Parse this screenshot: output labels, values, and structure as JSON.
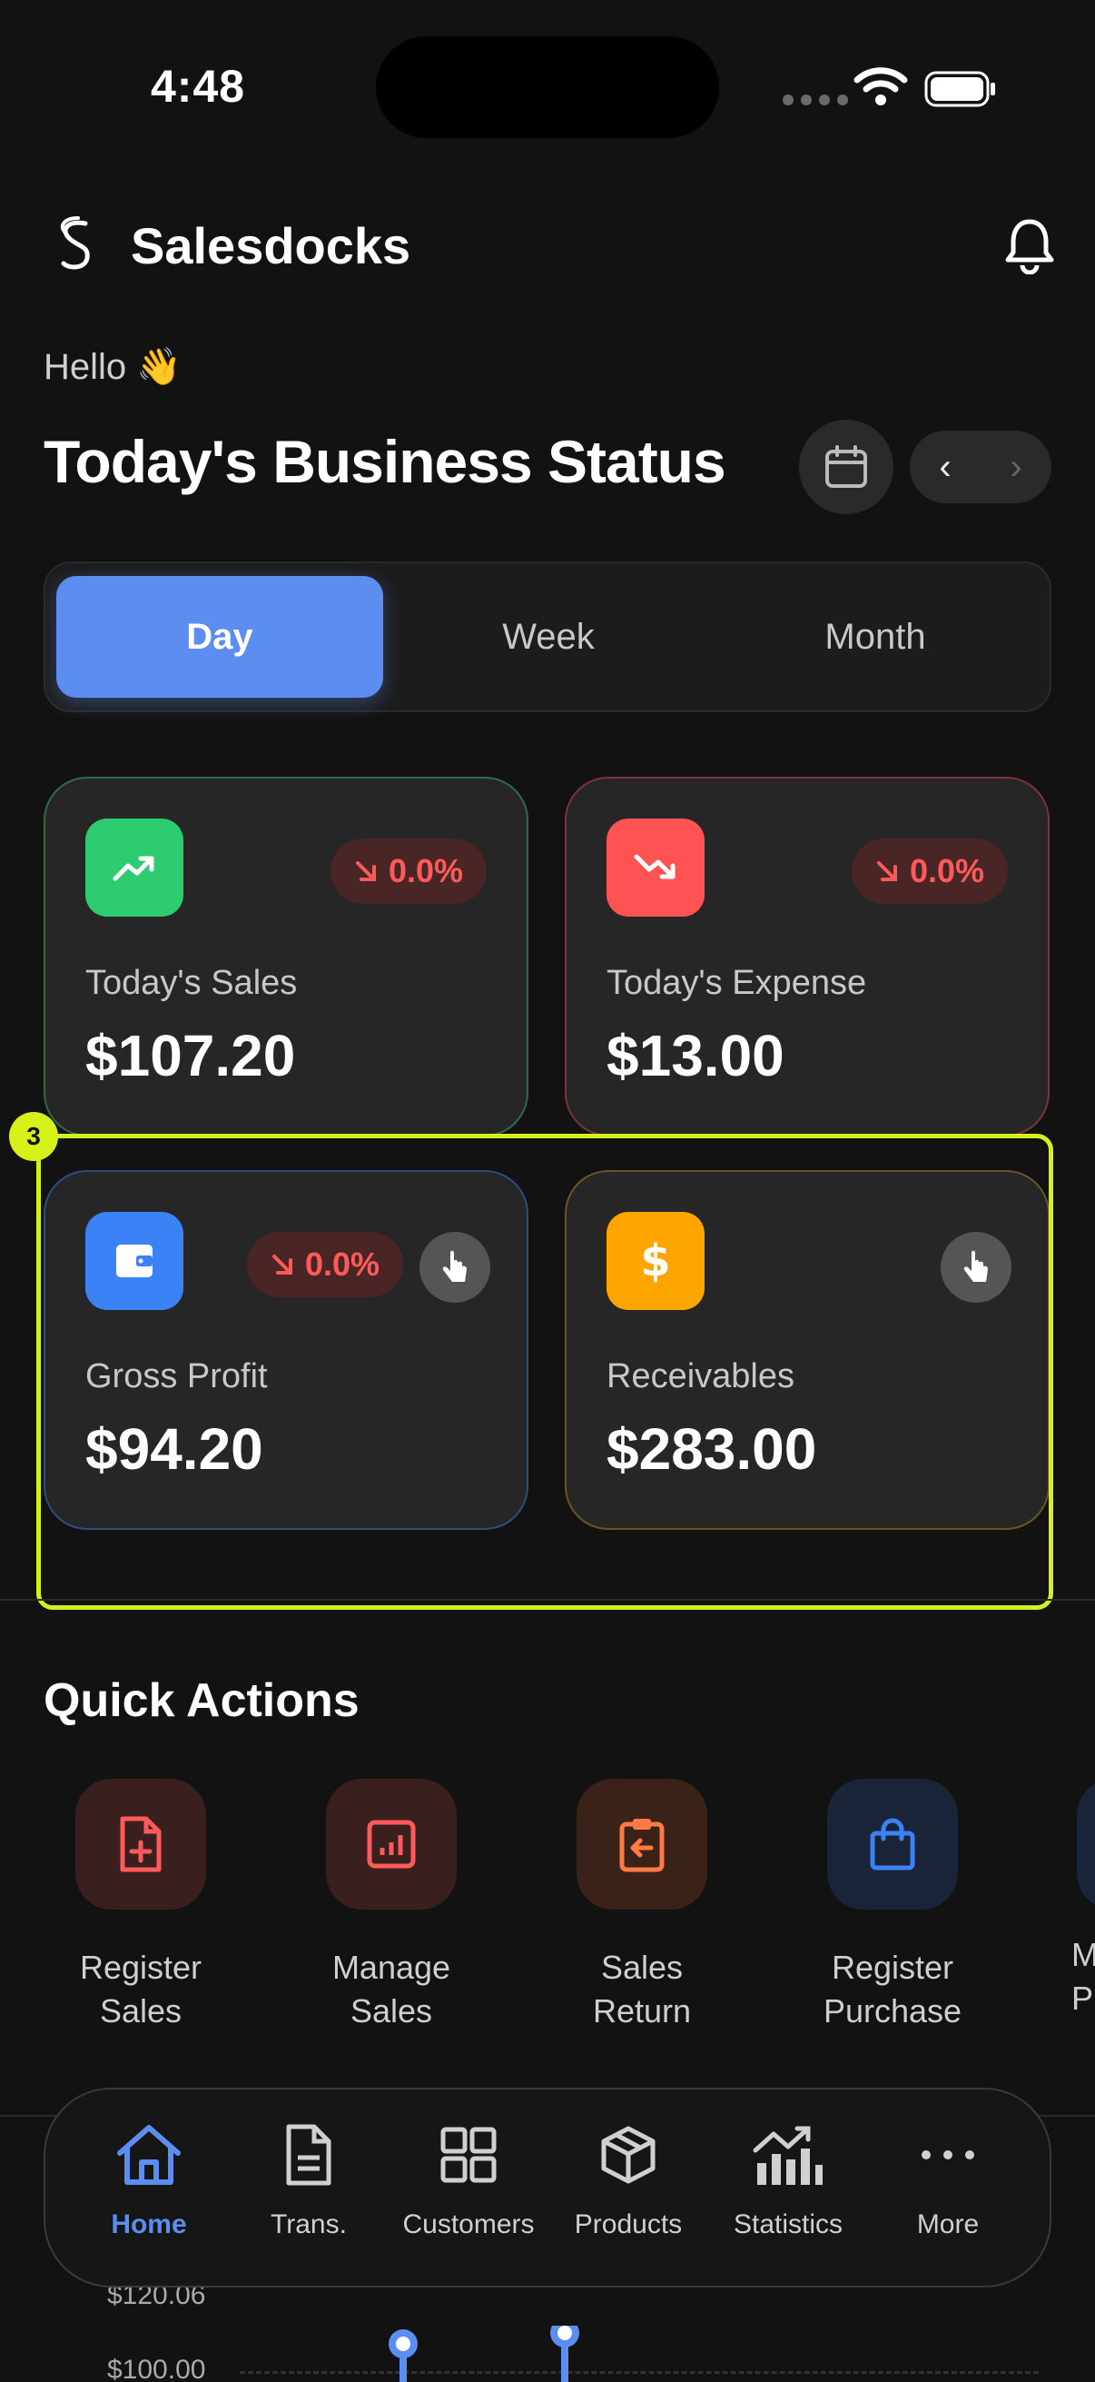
{
  "status_bar": {
    "time": "4:48"
  },
  "header": {
    "brand": "Salesdocks",
    "greeting": "Hello 👋",
    "title": "Today's Business Status"
  },
  "segments": [
    {
      "label": "Day",
      "active": true
    },
    {
      "label": "Week",
      "active": false
    },
    {
      "label": "Month",
      "active": false
    }
  ],
  "cards": {
    "sales": {
      "label": "Today's Sales",
      "value": "$107.20",
      "change": "0.0%",
      "accent": "#2ecc71"
    },
    "expense": {
      "label": "Today's Expense",
      "value": "$13.00",
      "change": "0.0%",
      "accent": "#ff5252"
    },
    "profit": {
      "label": "Gross Profit",
      "value": "$94.20",
      "change": "0.0%",
      "accent": "#3b82f6"
    },
    "receivables": {
      "label": "Receivables",
      "value": "$283.00",
      "accent": "#ffa500"
    }
  },
  "highlight": {
    "label": "3"
  },
  "quick_actions": {
    "title": "Quick Actions",
    "items": [
      {
        "label": "Register Sales",
        "line1": "Register",
        "line2": "Sales",
        "icon": "file-plus-icon"
      },
      {
        "label": "Manage Sales",
        "line1": "Manage",
        "line2": "Sales",
        "icon": "bar-chart-icon"
      },
      {
        "label": "Sales Return",
        "line1": "Sales",
        "line2": "Return",
        "icon": "clipboard-return-icon"
      },
      {
        "label": "Register Purchase",
        "line1": "Register",
        "line2": "Purchase",
        "icon": "shopping-bag-icon"
      },
      {
        "label": "M P",
        "line1": "M",
        "line2": "P",
        "icon": "partial-icon"
      }
    ]
  },
  "chart_peek": {
    "tick_top": "$120.06",
    "tick_bottom": "$100.00"
  },
  "bottom_nav": [
    {
      "label": "Home",
      "icon": "home-icon",
      "active": true
    },
    {
      "label": "Trans.",
      "icon": "document-icon",
      "active": false
    },
    {
      "label": "Customers",
      "icon": "grid-icon",
      "active": false
    },
    {
      "label": "Products",
      "icon": "box-icon",
      "active": false
    },
    {
      "label": "Statistics",
      "icon": "statistics-icon",
      "active": false
    },
    {
      "label": "More",
      "icon": "more-icon",
      "active": false
    }
  ],
  "colors": {
    "primary": "#5b8ef0",
    "background": "#121212",
    "card": "#262626",
    "highlight": "#d6f01a",
    "negative": "#ff5a5a"
  }
}
